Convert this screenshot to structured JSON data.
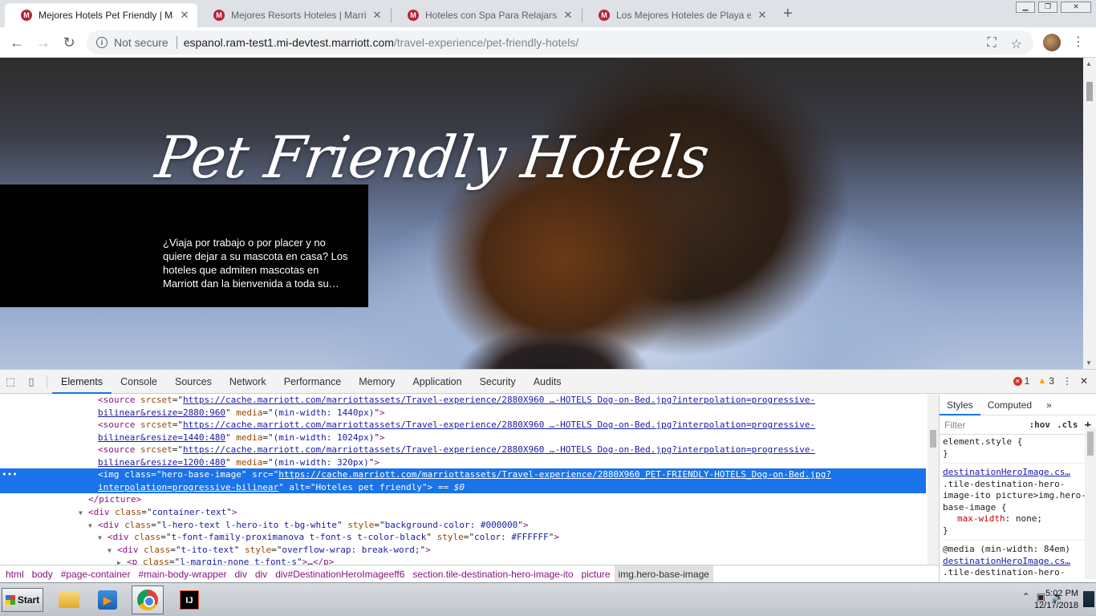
{
  "browser": {
    "tabs": [
      {
        "title": "Mejores Hotels Pet Friendly | Marriott",
        "active": true
      },
      {
        "title": "Mejores Resorts Hoteles | Marriott In",
        "active": false
      },
      {
        "title": "Hoteles con Spa Para Relajarse | Ma",
        "active": false
      },
      {
        "title": "Los Mejores Hoteles de Playa en el M",
        "active": false
      }
    ],
    "new_tab_label": "+",
    "security_label": "Not secure",
    "url_host": "espanol.ram-test1.mi-devtest.marriott.com",
    "url_path": "/travel-experience/pet-friendly-hotels/"
  },
  "hero": {
    "title": "Pet Friendly Hotels",
    "text": "¿Viaja por trabajo o por placer y no quiere dejar a su mascota en casa? Los hoteles que admiten mascotas en Marriott dan la bienvenida a toda su…"
  },
  "devtools": {
    "tabs": [
      "Elements",
      "Console",
      "Sources",
      "Network",
      "Performance",
      "Memory",
      "Application",
      "Security",
      "Audits"
    ],
    "active_tab": "Elements",
    "error_count": "1",
    "warning_count": "3",
    "dom": {
      "src1_url": "https://cache.marriott.com/marriottassets/Travel-experience/2880X960 …-HOTELS Dog-on-Bed.jpg?interpolation=progressive-",
      "src1_url2": "bilinear&resize=2880:960",
      "src1_media": "(min-width: 1440px)",
      "src2_url": "https://cache.marriott.com/marriottassets/Travel-experience/2880X960 …-HOTELS Dog-on-Bed.jpg?interpolation=progressive-",
      "src2_url2": "bilinear&resize=1440:480",
      "src2_media": "(min-width: 1024px)",
      "src3_url": "https://cache.marriott.com/marriottassets/Travel-experience/2880X960 …-HOTELS Dog-on-Bed.jpg?interpolation=progressive-",
      "src3_url2": "bilinear&resize=1200:480",
      "src3_media": "(min-width: 320px)",
      "img_class": "hero-base-image",
      "img_src": "https://cache.marriott.com/marriottassets/Travel-experience/2880X960_PET-FRIENDLY-HOTELS_Dog-on-Bed.jpg?",
      "img_src2": "interpolation=progressive-bilinear",
      "img_alt": "Hoteles pet friendly",
      "img_marker": "== $0",
      "div1_class": "container-text",
      "div2_class": "l-hero-text l-hero-ito t-bg-white",
      "div2_style": "background-color: #000000",
      "div3_class": "t-font-family-proximanova t-font-s t-color-black",
      "div3_style": "color: #FFFFFF",
      "div4_class": "t-ito-text",
      "div4_style": "overflow-wrap: break-word;",
      "p_class": "l-margin-none t-font-s"
    },
    "breadcrumbs": [
      "html",
      "body",
      "#page-container",
      "#main-body-wrapper",
      "div",
      "div",
      "div#DestinationHeroImageeff6",
      "section.tile-destination-hero-image-ito",
      "picture",
      "img.hero-base-image"
    ],
    "styles": {
      "tabs": [
        "Styles",
        "Computed"
      ],
      "filter_placeholder": "Filter",
      "hov": ":hov",
      "cls": ".cls",
      "rule1_selector": "element.style {",
      "rule1_close": "}",
      "rule2_source": "destinationHeroImage.cs…",
      "rule2_selector": ".tile-destination-hero-image-ito picture>img.hero-base-image {",
      "rule2_prop": "max-width",
      "rule2_value": "none;",
      "rule2_close": "}",
      "rule3_media": "@media (min-width: 84em)",
      "rule3_source": "destinationHeroImage.cs…",
      "rule3_selector": ".tile-destination-hero-"
    }
  },
  "taskbar": {
    "start_label": "Start",
    "ij_label": "IJ",
    "time": "5:02 PM",
    "date": "12/17/2018"
  }
}
